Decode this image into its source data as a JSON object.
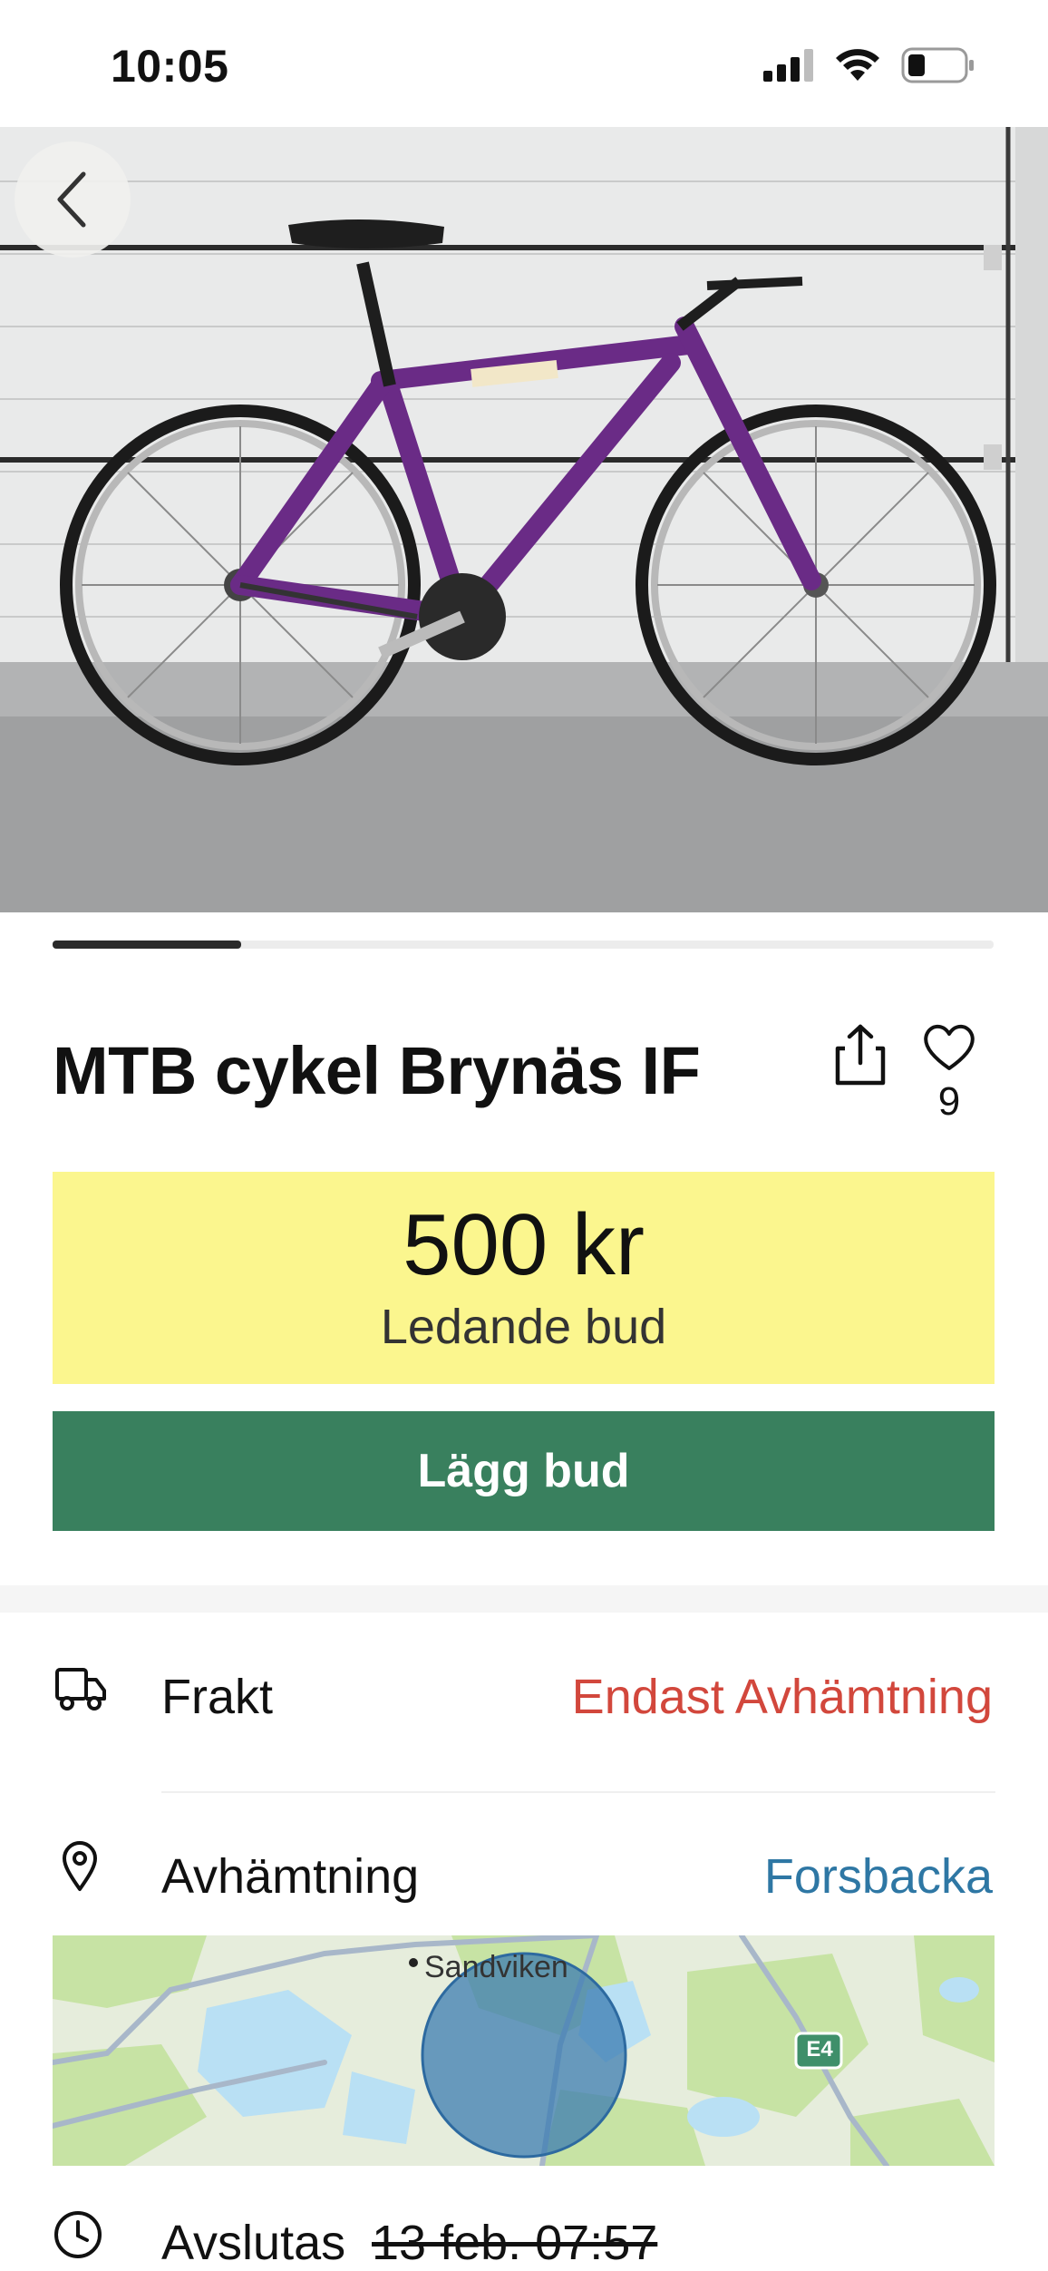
{
  "status_bar": {
    "time": "10:05",
    "icons": [
      "signal-icon",
      "wifi-icon",
      "battery-icon"
    ]
  },
  "listing": {
    "title": "MTB cykel Brynäs IF",
    "like_count": "9",
    "price": "500 kr",
    "price_label": "Ledande bud",
    "bid_button": "Lägg bud",
    "carousel": {
      "current": 1,
      "progress": 0.2
    }
  },
  "details": {
    "shipping": {
      "label": "Frakt",
      "value": "Endast Avhämtning",
      "value_color": "#d2473c",
      "icon": "truck-icon"
    },
    "pickup": {
      "label": "Avhämtning",
      "value": "Forsbacka",
      "value_color": "#2e77a4",
      "icon": "location-pin-icon"
    },
    "ends": {
      "label": "Avslutas",
      "value": "13 feb. 07:57",
      "icon": "clock-icon"
    }
  },
  "map": {
    "place_label": "Sandviken",
    "road_label": "E4"
  },
  "colors": {
    "accent_green": "#39805e",
    "price_yellow": "#fbf68e"
  }
}
